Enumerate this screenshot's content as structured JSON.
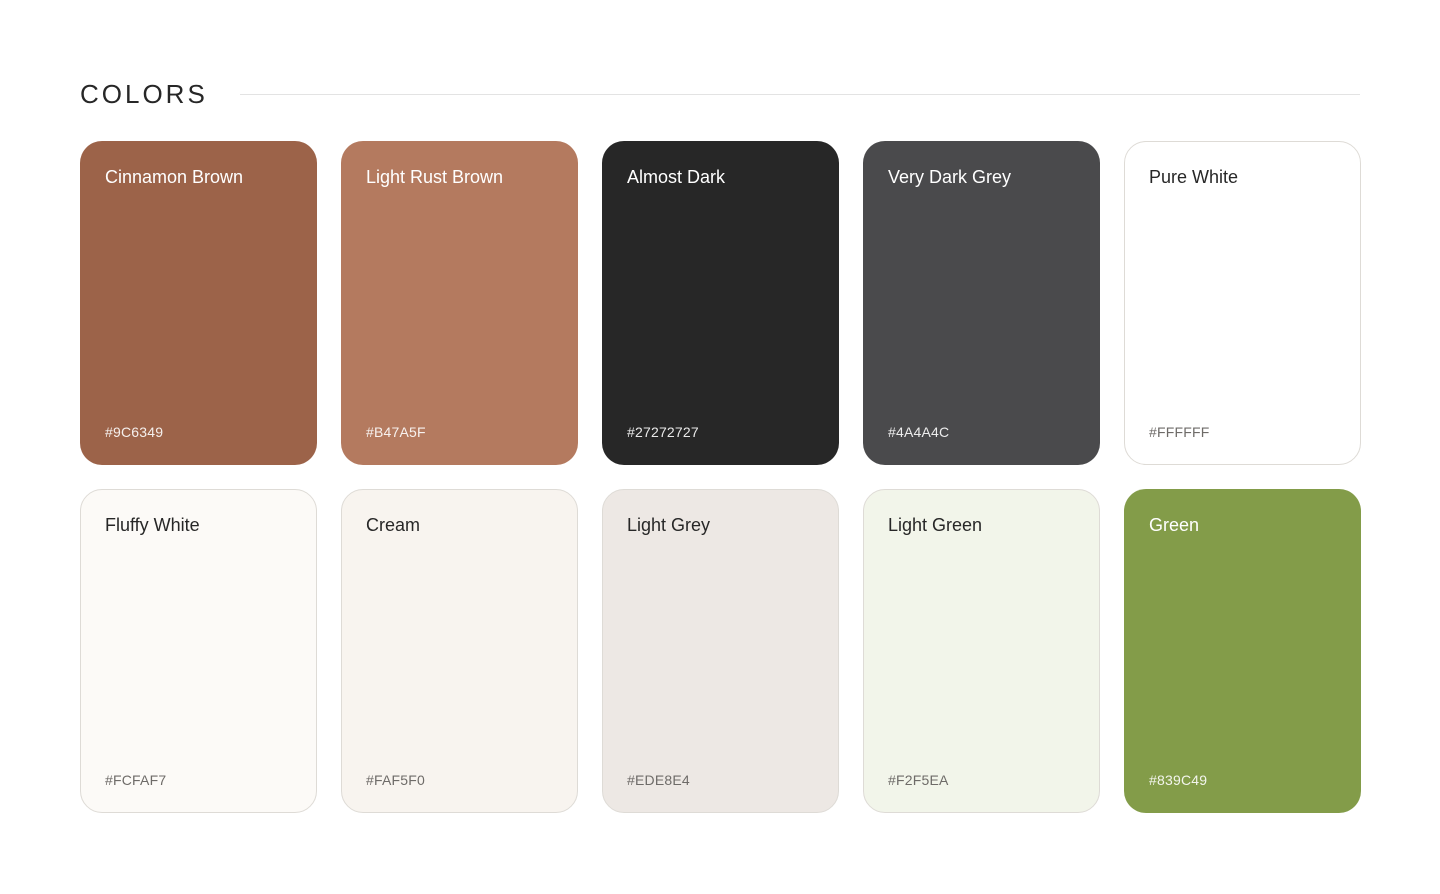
{
  "section": {
    "title": "COLORS"
  },
  "swatches": [
    {
      "name": "Cinnamon Brown",
      "hex": "#9C6349",
      "color": "#9C6349",
      "text": "dark"
    },
    {
      "name": "Light Rust Brown",
      "hex": "#B47A5F",
      "color": "#B47A5F",
      "text": "dark"
    },
    {
      "name": "Almost Dark",
      "hex": "#27272727",
      "color": "#272727",
      "text": "dark"
    },
    {
      "name": "Very Dark Grey",
      "hex": "#4A4A4C",
      "color": "#4A4A4C",
      "text": "dark"
    },
    {
      "name": "Pure White",
      "hex": "#FFFFFF",
      "color": "#FFFFFF",
      "text": "light"
    },
    {
      "name": "Fluffy White",
      "hex": "#FCFAF7",
      "color": "#FCFAF7",
      "text": "light"
    },
    {
      "name": "Cream",
      "hex": "#FAF5F0",
      "color": "#F8F4EF",
      "text": "light"
    },
    {
      "name": "Light Grey",
      "hex": "#EDE8E4",
      "color": "#EDE8E4",
      "text": "light"
    },
    {
      "name": "Light Green",
      "hex": "#F2F5EA",
      "color": "#F2F5EA",
      "text": "light"
    },
    {
      "name": "Green",
      "hex": "#839C49",
      "color": "#839C49",
      "text": "dark"
    }
  ]
}
